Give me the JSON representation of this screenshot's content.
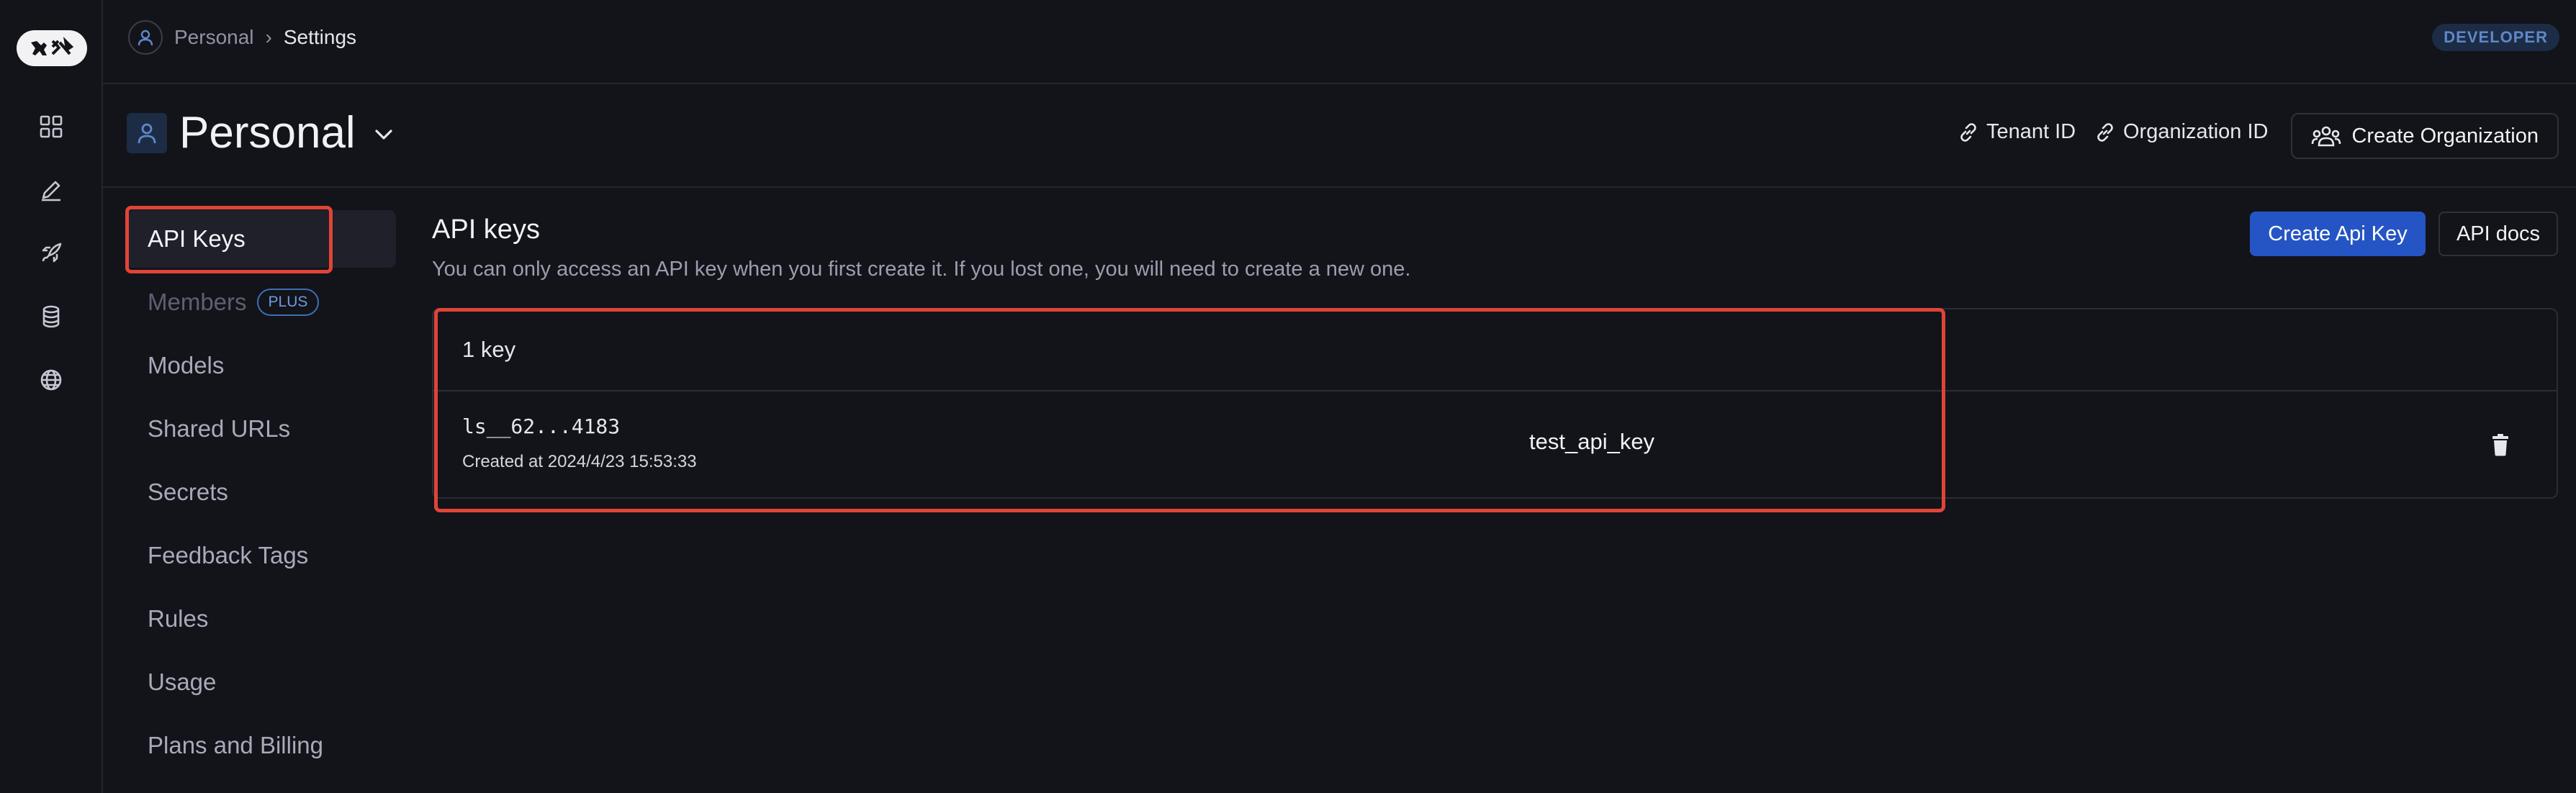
{
  "breadcrumb": {
    "workspace": "Personal",
    "separator": "›",
    "current": "Settings"
  },
  "badge": "DEVELOPER",
  "header": {
    "title": "Personal",
    "tenant_label": "Tenant ID",
    "org_id_label": "Organization ID",
    "create_org_label": "Create Organization"
  },
  "nav": {
    "items": [
      {
        "label": "API Keys",
        "state": "active"
      },
      {
        "label": "Members",
        "badge": "PLUS",
        "state": "disabled"
      },
      {
        "label": "Models"
      },
      {
        "label": "Shared URLs"
      },
      {
        "label": "Secrets"
      },
      {
        "label": "Feedback Tags"
      },
      {
        "label": "Rules"
      },
      {
        "label": "Usage"
      },
      {
        "label": "Plans and Billing"
      }
    ]
  },
  "main": {
    "title": "API keys",
    "description": "You can only access an API key when you first create it. If you lost one, you will need to create a new one.",
    "create_button": "Create Api Key",
    "docs_button": "API docs",
    "count_label": "1 key",
    "keys": [
      {
        "id": "ls__62...4183",
        "created": "Created at 2024/4/23 15:53:33",
        "name": "test_api_key"
      }
    ]
  },
  "icons": {
    "rail": [
      "grid-icon",
      "pen-icon",
      "rocket-icon",
      "database-icon",
      "globe-icon"
    ]
  },
  "colors": {
    "background": "#13131a",
    "accent": "#2555c4",
    "highlight": "#e04436",
    "badge_bg": "#1d2c45"
  }
}
